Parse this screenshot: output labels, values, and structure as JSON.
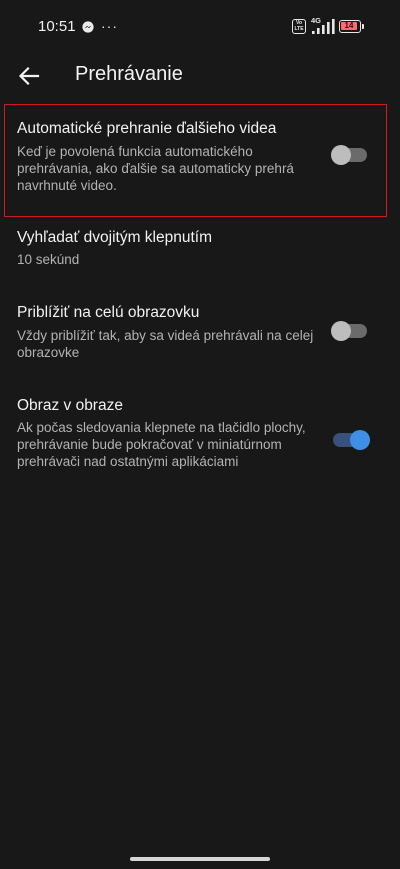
{
  "status_bar": {
    "time": "10:51",
    "more": "···",
    "network_type": "4G",
    "battery_level": "14",
    "colors": {
      "battery_fill": "#ff6b70"
    }
  },
  "app_bar": {
    "title": "Prehrávanie",
    "back_icon": "arrow-left-icon"
  },
  "settings": [
    {
      "title": "Automatické prehranie ďalšieho videa",
      "description": "Keď je povolená funkcia automatického prehrávania, ako ďalšie sa automaticky prehrá navrhnuté video.",
      "toggle": false
    },
    {
      "title": "Vyhľadať dvojitým klepnutím",
      "description": "10 sekúnd"
    },
    {
      "title": "Priblížiť na celú obrazovku",
      "description": "Vždy priblížiť tak, aby sa videá prehrávali na celej obrazovke",
      "toggle": false
    },
    {
      "title": "Obraz v obraze",
      "description": "Ak počas sledovania klepnete na tlačidlo plochy, prehrávanie bude pokračovať v miniatúrnom prehrávači nad ostatnými aplikáciami",
      "toggle": true
    }
  ],
  "colors": {
    "background": "#181818",
    "highlight_border": "#cf1d1d",
    "toggle_on": "#3f8ee8"
  }
}
